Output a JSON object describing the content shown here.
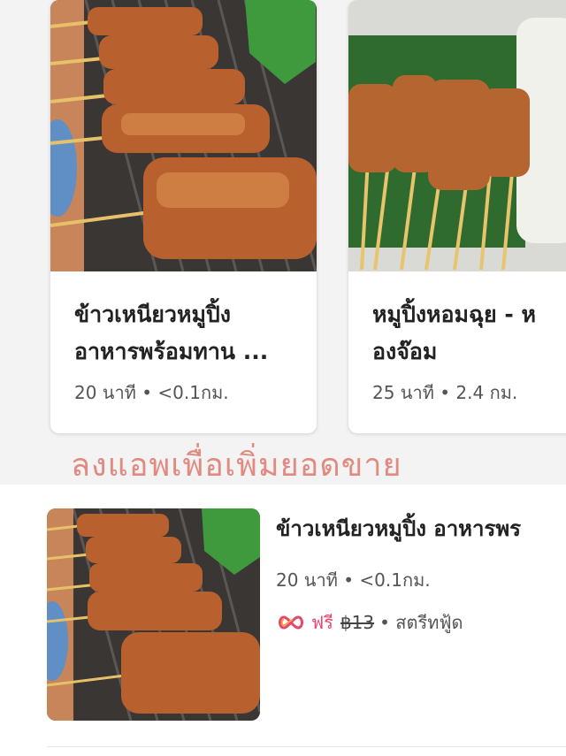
{
  "cards": [
    {
      "title_line1": "ข้าวเหนียวหมูปิ้ง",
      "title_line2": "อาหารพร้อมทาน ...",
      "time": "20 นาที",
      "distance": "<0.1กม."
    },
    {
      "title_line1": "หมูปิ้งหอมฉุย - ห",
      "title_line2": "องจ๊อม",
      "time": "25 นาที",
      "distance": "2.4 กม."
    }
  ],
  "overlay_caption": "ลงแอพเพื่อเพิ่มยอดขาย",
  "list_item": {
    "title": "ข้าวเหนียวหมูปิ้ง อาหารพร",
    "time": "20 นาที",
    "distance": "<0.1กม.",
    "free_label": "ฟรี",
    "original_fee": "฿13",
    "category": "สตรีทฟู้ด"
  },
  "dot_separator": "•",
  "colors": {
    "promo_pink": "#e8466e",
    "caption": "#e08a80"
  }
}
